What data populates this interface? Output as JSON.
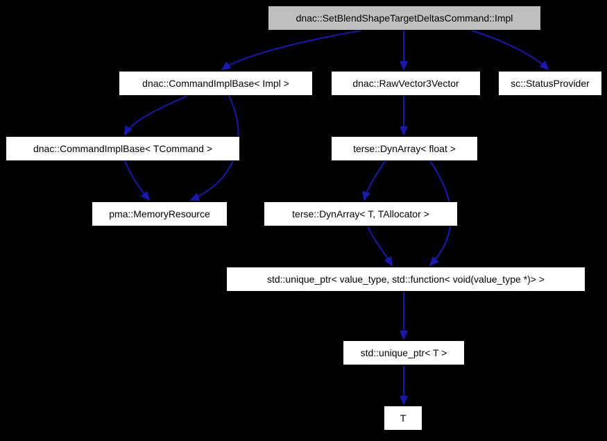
{
  "nodes": {
    "root": {
      "label": "dnac::SetBlendShapeTargetDeltasCommand::Impl"
    },
    "cmdimplimpl": {
      "label": "dnac::CommandImplBase< Impl >"
    },
    "rawvec": {
      "label": "dnac::RawVector3Vector"
    },
    "status": {
      "label": "sc::StatusProvider"
    },
    "cmdimpltcmd": {
      "label": "dnac::CommandImplBase< TCommand >"
    },
    "dynfloat": {
      "label": "terse::DynArray< float >"
    },
    "memres": {
      "label": "pma::MemoryResource"
    },
    "dynT": {
      "label": "terse::DynArray< T, TAllocator >"
    },
    "uniqptrfull": {
      "label": "std::unique_ptr< value_type, std::function< void(value_type *)> >"
    },
    "uniqptrT": {
      "label": "std::unique_ptr< T >"
    },
    "T": {
      "label": "T"
    }
  },
  "edges": [
    {
      "from": "root",
      "to": "cmdimplimpl"
    },
    {
      "from": "root",
      "to": "rawvec"
    },
    {
      "from": "root",
      "to": "status"
    },
    {
      "from": "cmdimplimpl",
      "to": "cmdimpltcmd"
    },
    {
      "from": "cmdimplimpl",
      "to": "memres"
    },
    {
      "from": "cmdimpltcmd",
      "to": "memres"
    },
    {
      "from": "rawvec",
      "to": "dynfloat"
    },
    {
      "from": "dynfloat",
      "to": "dynT"
    },
    {
      "from": "dynfloat",
      "to": "uniqptrfull"
    },
    {
      "from": "dynT",
      "to": "uniqptrfull"
    },
    {
      "from": "uniqptrfull",
      "to": "uniqptrT"
    },
    {
      "from": "uniqptrT",
      "to": "T"
    }
  ]
}
